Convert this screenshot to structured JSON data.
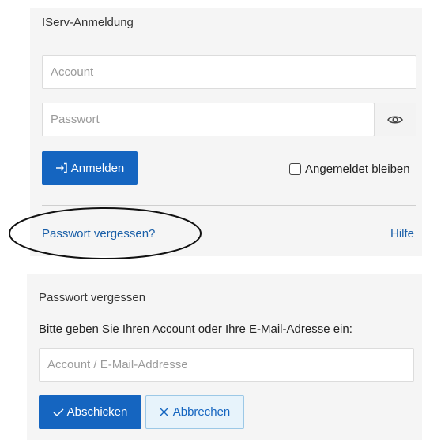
{
  "login": {
    "title": "IServ-Anmeldung",
    "account_placeholder": "Account",
    "password_placeholder": "Passwort",
    "login_button": "Anmelden",
    "remember_label": "Angemeldet bleiben",
    "forgot_link": "Passwort vergessen?",
    "help_link": "Hilfe"
  },
  "forgot": {
    "title": "Passwort vergessen",
    "instruction": "Bitte geben Sie Ihren Account oder Ihre E-Mail-Adresse ein:",
    "input_placeholder": "Account / E-Mail-Addresse",
    "submit_button": "Abschicken",
    "cancel_button": "Abbrechen"
  },
  "icons": {
    "login": "login-arrow-icon",
    "eye": "eye-icon",
    "check": "check-icon",
    "cancel": "x-icon"
  },
  "colors": {
    "primary": "#1565c0",
    "link": "#1a5fa8",
    "panel": "#f5f5f5"
  }
}
